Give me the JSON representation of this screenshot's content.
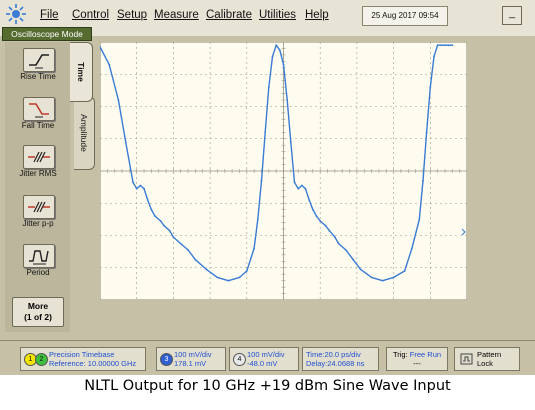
{
  "menu": {
    "items": [
      "File",
      "Control",
      "Setup",
      "Measure",
      "Calibrate",
      "Utilities",
      "Help"
    ],
    "datetime": "25 Aug 2017  09:54",
    "minimize_label": "_",
    "mode_label": "Oscilloscope Mode"
  },
  "left_panel": {
    "tools": [
      {
        "label": "Rise Time",
        "icon": "rise-time-icon"
      },
      {
        "label": "Fall Time",
        "icon": "fall-time-icon"
      },
      {
        "label": "Jitter RMS",
        "icon": "jitter-rms-icon"
      },
      {
        "label": "Jitter p-p",
        "icon": "jitter-pp-icon"
      },
      {
        "label": "Period",
        "icon": "period-icon"
      }
    ],
    "more_label_1": "More",
    "more_label_2": "(1 of 2)"
  },
  "tabs": {
    "time": "Time",
    "amplitude": "Amplitude"
  },
  "status_bar": {
    "precision_timebase": "Precision Timebase",
    "reference": "Reference: 10.00000 GHz",
    "ch3_scale": "100 mV/div",
    "ch3_offset": "178.1 mV",
    "ch4_scale": "100 mV/div",
    "ch4_offset": "-48.0 mV",
    "time_scale": "Time:20.0 ps/div",
    "delay": "Delay:24.0688 ns",
    "trig_label": "Trig:",
    "trig_mode": "Free Run",
    "trig_sub": "---",
    "pattern_lock_1": "Pattern",
    "pattern_lock_2": "Lock"
  },
  "caption": "NLTL Output for 10 GHz +19 dBm Sine Wave Input",
  "colors": {
    "trace": "#3a7bd5",
    "background": "#fdfcef",
    "grid": "#9a9888",
    "chrome": "#c5c0a6"
  },
  "chart_data": {
    "type": "line",
    "xlabel": "",
    "ylabel": "",
    "x_unit": "ps",
    "y_unit": "div",
    "xlim": [
      0,
      200
    ],
    "ylim": [
      -4,
      4
    ],
    "grid": true,
    "series": [
      {
        "x": [
          0,
          5,
          10,
          14,
          18,
          20,
          22,
          24,
          26,
          28,
          30,
          33,
          35,
          38,
          40,
          44,
          48,
          52,
          58,
          64,
          70,
          76,
          80,
          84,
          86,
          88,
          90,
          92,
          94,
          96,
          98,
          100,
          102,
          104,
          106,
          108,
          110,
          112,
          114,
          116,
          118,
          120,
          123,
          125,
          128,
          130,
          134,
          138,
          142,
          148,
          154,
          160,
          166,
          170,
          174,
          176,
          178,
          180,
          182,
          184,
          186,
          188,
          190,
          192
        ],
        "y": [
          3.85,
          3.3,
          2.2,
          0.9,
          -0.35,
          -0.55,
          -0.45,
          -0.55,
          -0.9,
          -1.2,
          -1.4,
          -1.55,
          -1.7,
          -1.85,
          -2.05,
          -2.25,
          -2.45,
          -2.75,
          -3.05,
          -3.3,
          -3.4,
          -3.3,
          -3.1,
          -2.4,
          -1.5,
          -0.3,
          1.2,
          2.6,
          3.55,
          3.9,
          3.75,
          3.3,
          2.2,
          0.9,
          -0.35,
          -0.55,
          -0.45,
          -0.55,
          -0.9,
          -1.2,
          -1.4,
          -1.55,
          -1.7,
          -1.85,
          -2.05,
          -2.25,
          -2.45,
          -2.75,
          -3.05,
          -3.3,
          -3.4,
          -3.3,
          -3.1,
          -2.4,
          -1.5,
          -0.3,
          1.2,
          2.6,
          3.55,
          3.9,
          3.9,
          3.9,
          3.9,
          3.9
        ]
      }
    ]
  }
}
